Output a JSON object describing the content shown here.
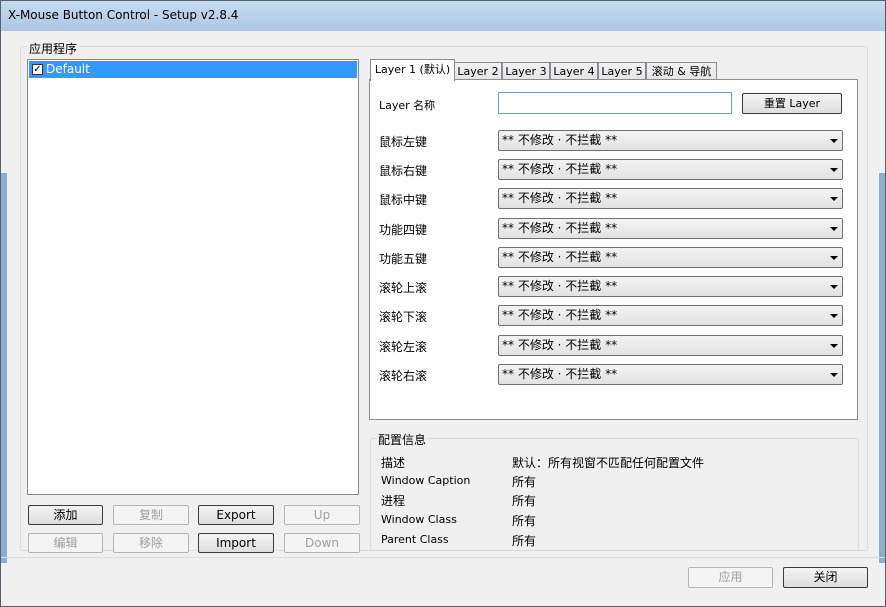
{
  "window": {
    "title": "X-Mouse Button Control - Setup v2.8.4"
  },
  "apps": {
    "legend": "应用程序",
    "items": [
      {
        "label": "Default",
        "checked": "✓"
      }
    ],
    "buttons": {
      "add": "添加",
      "copy": "复制",
      "export": "Export",
      "up": "Up",
      "edit": "编辑",
      "remove": "移除",
      "import": "Import",
      "down": "Down"
    }
  },
  "tabs": [
    "Layer 1 (默认)",
    "Layer 2",
    "Layer 3",
    "Layer 4",
    "Layer 5",
    "滚动 & 导航"
  ],
  "layer": {
    "name_label": "Layer 名称",
    "name_value": "",
    "reset_button": "重置 Layer",
    "rows": [
      {
        "label": "鼠标左键",
        "value": "** 不修改 · 不拦截 **"
      },
      {
        "label": "鼠标右键",
        "value": "** 不修改 · 不拦截 **"
      },
      {
        "label": "鼠标中键",
        "value": "** 不修改 · 不拦截 **"
      },
      {
        "label": "功能四键",
        "value": "** 不修改 · 不拦截 **"
      },
      {
        "label": "功能五键",
        "value": "** 不修改 · 不拦截 **"
      },
      {
        "label": "滚轮上滚",
        "value": "** 不修改 · 不拦截 **"
      },
      {
        "label": "滚轮下滚",
        "value": "** 不修改 · 不拦截 **"
      },
      {
        "label": "滚轮左滚",
        "value": "** 不修改 · 不拦截 **"
      },
      {
        "label": "滚轮右滚",
        "value": "** 不修改 · 不拦截 **"
      }
    ]
  },
  "info": {
    "legend": "配置信息",
    "rows": [
      {
        "label": "描述",
        "value": "默认：所有视窗不匹配任何配置文件"
      },
      {
        "label": "Window Caption",
        "value": "所有"
      },
      {
        "label": "进程",
        "value": "所有"
      },
      {
        "label": "Window Class",
        "value": "所有"
      },
      {
        "label": "Parent Class",
        "value": "所有"
      }
    ]
  },
  "footer": {
    "apply": "应用",
    "close": "关闭"
  }
}
